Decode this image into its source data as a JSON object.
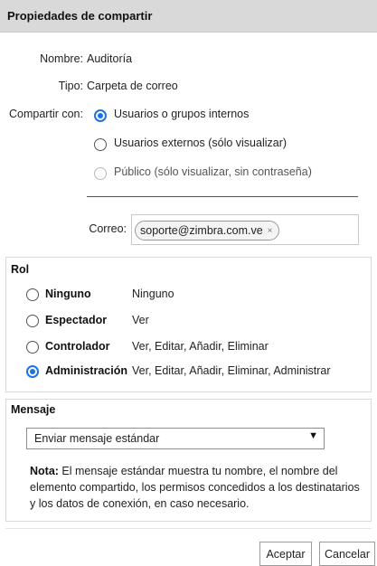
{
  "dialog": {
    "title": "Propiedades de compartir"
  },
  "info": {
    "name_label": "Nombre:",
    "name_value": "Auditoría",
    "type_label": "Tipo:",
    "type_value": "Carpeta de correo"
  },
  "share_with": {
    "label": "Compartir con:",
    "options": [
      {
        "label": "Usuarios o grupos internos",
        "selected": true
      },
      {
        "label": "Usuarios externos (sólo visualizar)",
        "selected": false
      },
      {
        "label": "Público (sólo visualizar, sin contraseña)",
        "selected": false,
        "disabled": true
      }
    ]
  },
  "email": {
    "label": "Correo:",
    "chips": [
      {
        "address": "soporte@zimbra.com.ve",
        "remove": "×"
      }
    ]
  },
  "role": {
    "heading": "Rol",
    "options": [
      {
        "name": "Ninguno",
        "description": "Ninguno",
        "selected": false
      },
      {
        "name": "Espectador",
        "description": "Ver",
        "selected": false
      },
      {
        "name": "Controlador",
        "description": "Ver, Editar, Añadir, Eliminar",
        "selected": false
      },
      {
        "name": "Administración",
        "description": "Ver, Editar, Añadir, Eliminar, Administrar",
        "selected": true
      }
    ]
  },
  "message": {
    "heading": "Mensaje",
    "select_value": "Enviar mensaje estándar",
    "note_label": "Nota:",
    "note_text": " El mensaje estándar muestra tu nombre, el nombre del elemento compartido, los permisos concedidos a los destinatarios y los datos de conexión, en caso necesario."
  },
  "buttons": {
    "accept": "Aceptar",
    "cancel": "Cancelar"
  },
  "colors": {
    "accent": "#1a73e8",
    "titlebar": "#d9d9d9",
    "border": "#d9d9d9"
  }
}
